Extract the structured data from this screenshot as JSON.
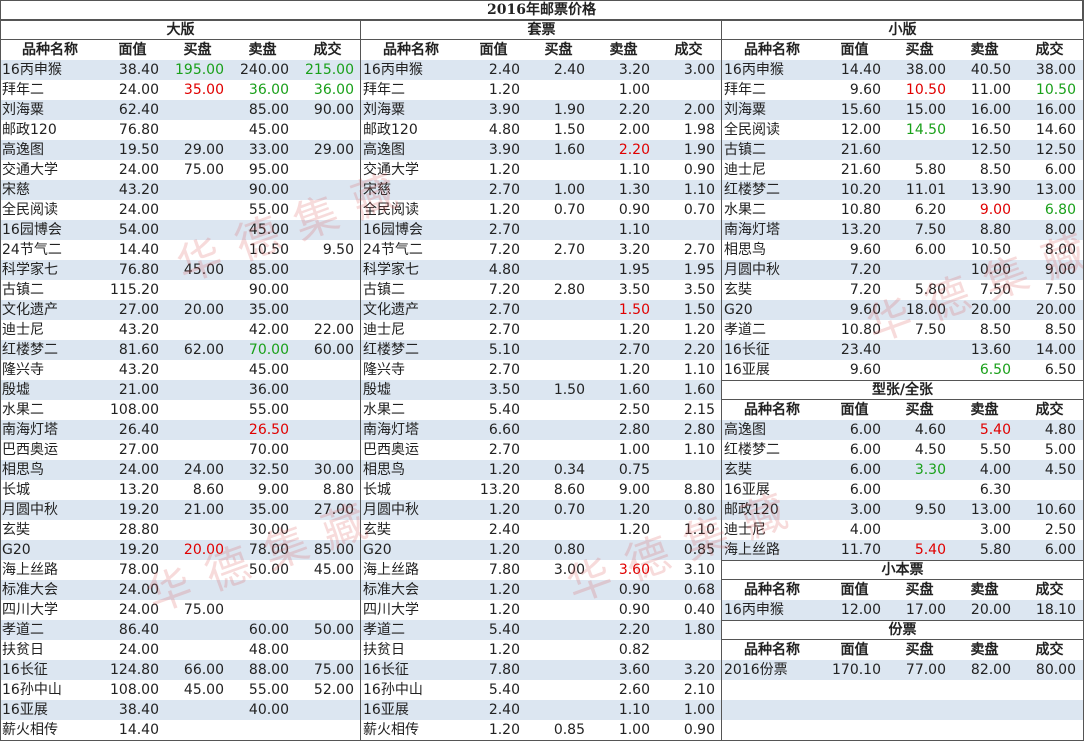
{
  "title": "2016年邮票价格",
  "headers": [
    "品种名称",
    "面值",
    "买盘",
    "卖盘",
    "成交"
  ],
  "watermark_text": "华德集藏",
  "colors": {
    "stripe": "#dce6f1",
    "red": "#e00000",
    "green": "#1aa01a"
  },
  "sections": {
    "daban": {
      "title": "大版",
      "rows": [
        [
          "16丙申猴",
          "38.40",
          "195.00",
          "240.00",
          "215.00"
        ],
        [
          "拜年二",
          "24.00",
          "35.00",
          "36.00",
          "36.00"
        ],
        [
          "刘海粟",
          "62.40",
          "",
          "85.00",
          "90.00"
        ],
        [
          "邮政120",
          "76.80",
          "",
          "45.00",
          ""
        ],
        [
          "高逸图",
          "19.50",
          "29.00",
          "33.00",
          "29.00"
        ],
        [
          "交通大学",
          "24.00",
          "75.00",
          "95.00",
          ""
        ],
        [
          "宋慈",
          "43.20",
          "",
          "90.00",
          ""
        ],
        [
          "全民阅读",
          "24.00",
          "",
          "55.00",
          ""
        ],
        [
          "16园博会",
          "54.00",
          "",
          "45.00",
          ""
        ],
        [
          "24节气二",
          "14.40",
          "",
          "10.50",
          "9.50"
        ],
        [
          "科学家七",
          "76.80",
          "45.00",
          "85.00",
          ""
        ],
        [
          "古镇二",
          "115.20",
          "",
          "90.00",
          ""
        ],
        [
          "文化遗产",
          "27.00",
          "20.00",
          "35.00",
          ""
        ],
        [
          "迪士尼",
          "43.20",
          "",
          "42.00",
          "22.00"
        ],
        [
          "红楼梦二",
          "81.60",
          "62.00",
          "70.00",
          "60.00"
        ],
        [
          "隆兴寺",
          "43.20",
          "",
          "45.00",
          ""
        ],
        [
          "殷墟",
          "21.00",
          "",
          "36.00",
          ""
        ],
        [
          "水果二",
          "108.00",
          "",
          "55.00",
          ""
        ],
        [
          "南海灯塔",
          "26.40",
          "",
          "26.50",
          ""
        ],
        [
          "巴西奥运",
          "27.00",
          "",
          "70.00",
          ""
        ],
        [
          "相思鸟",
          "24.00",
          "24.00",
          "32.50",
          "30.00"
        ],
        [
          "长城",
          "13.20",
          "8.60",
          "9.00",
          "8.80"
        ],
        [
          "月圆中秋",
          "19.20",
          "21.00",
          "35.00",
          "27.00"
        ],
        [
          "玄奘",
          "28.80",
          "",
          "30.00",
          ""
        ],
        [
          "G20",
          "19.20",
          "20.00",
          "78.00",
          "85.00"
        ],
        [
          "海上丝路",
          "78.00",
          "",
          "50.00",
          "45.00"
        ],
        [
          "标准大会",
          "24.00",
          "",
          "",
          ""
        ],
        [
          "四川大学",
          "24.00",
          "75.00",
          "",
          ""
        ],
        [
          "孝道二",
          "86.40",
          "",
          "60.00",
          "50.00"
        ],
        [
          "扶贫日",
          "24.00",
          "",
          "48.00",
          ""
        ],
        [
          "16长征",
          "124.80",
          "66.00",
          "88.00",
          "75.00"
        ],
        [
          "16孙中山",
          "108.00",
          "45.00",
          "55.00",
          "52.00"
        ],
        [
          "16亚展",
          "38.40",
          "",
          "40.00",
          ""
        ],
        [
          "薪火相传",
          "14.40",
          "",
          "",
          ""
        ]
      ],
      "colored": {
        "0": {
          "2": "green",
          "4": "green"
        },
        "1": {
          "2": "red",
          "3": "green",
          "4": "green"
        },
        "14": {
          "3": "green"
        },
        "18": {
          "3": "red"
        },
        "24": {
          "2": "red"
        }
      }
    },
    "taopiao": {
      "title": "套票",
      "rows": [
        [
          "16丙申猴",
          "2.40",
          "2.40",
          "3.20",
          "3.00"
        ],
        [
          "拜年二",
          "1.20",
          "",
          "1.00",
          ""
        ],
        [
          "刘海粟",
          "3.90",
          "1.90",
          "2.20",
          "2.00"
        ],
        [
          "邮政120",
          "4.80",
          "1.50",
          "2.00",
          "1.98"
        ],
        [
          "高逸图",
          "3.90",
          "1.60",
          "2.20",
          "1.90"
        ],
        [
          "交通大学",
          "1.20",
          "",
          "1.10",
          "0.90"
        ],
        [
          "宋慈",
          "2.70",
          "1.00",
          "1.30",
          "1.10"
        ],
        [
          "全民阅读",
          "1.20",
          "0.70",
          "0.90",
          "0.70"
        ],
        [
          "16园博会",
          "2.70",
          "",
          "1.10",
          ""
        ],
        [
          "24节气二",
          "7.20",
          "2.70",
          "3.20",
          "2.70"
        ],
        [
          "科学家七",
          "4.80",
          "",
          "1.95",
          "1.95"
        ],
        [
          "古镇二",
          "7.20",
          "2.80",
          "3.50",
          "3.50"
        ],
        [
          "文化遗产",
          "2.70",
          "",
          "1.50",
          "1.50"
        ],
        [
          "迪士尼",
          "2.70",
          "",
          "1.20",
          "1.20"
        ],
        [
          "红楼梦二",
          "5.10",
          "",
          "2.70",
          "2.20"
        ],
        [
          "隆兴寺",
          "2.70",
          "",
          "1.20",
          "1.10"
        ],
        [
          "殷墟",
          "3.50",
          "1.50",
          "1.60",
          "1.60"
        ],
        [
          "水果二",
          "5.40",
          "",
          "2.50",
          "2.15"
        ],
        [
          "南海灯塔",
          "6.60",
          "",
          "2.80",
          "2.80"
        ],
        [
          "巴西奥运",
          "2.70",
          "",
          "1.00",
          "1.10"
        ],
        [
          "相思鸟",
          "1.20",
          "0.34",
          "0.75",
          ""
        ],
        [
          "长城",
          "13.20",
          "8.60",
          "9.00",
          "8.80"
        ],
        [
          "月圆中秋",
          "1.20",
          "0.70",
          "1.20",
          "0.80"
        ],
        [
          "玄奘",
          "2.40",
          "",
          "1.20",
          "1.10"
        ],
        [
          "G20",
          "1.20",
          "0.80",
          "",
          "0.85"
        ],
        [
          "海上丝路",
          "7.80",
          "3.00",
          "3.60",
          "3.10"
        ],
        [
          "标准大会",
          "1.20",
          "",
          "0.90",
          "0.68"
        ],
        [
          "四川大学",
          "1.20",
          "",
          "0.90",
          "0.40"
        ],
        [
          "孝道二",
          "5.40",
          "",
          "2.20",
          "1.80"
        ],
        [
          "扶贫日",
          "1.20",
          "",
          "0.82",
          ""
        ],
        [
          "16长征",
          "7.80",
          "",
          "3.60",
          "3.20"
        ],
        [
          "16孙中山",
          "5.40",
          "",
          "2.60",
          "2.10"
        ],
        [
          "16亚展",
          "2.40",
          "",
          "1.10",
          "1.00"
        ],
        [
          "薪火相传",
          "1.20",
          "0.85",
          "1.00",
          "0.90"
        ]
      ],
      "colored": {
        "4": {
          "3": "red"
        },
        "12": {
          "3": "red"
        },
        "25": {
          "3": "red"
        }
      }
    },
    "xiaoban": {
      "title": "小版",
      "rows": [
        [
          "16丙申猴",
          "14.40",
          "38.00",
          "40.50",
          "38.00"
        ],
        [
          "拜年二",
          "9.60",
          "10.50",
          "11.00",
          "10.50"
        ],
        [
          "刘海粟",
          "15.60",
          "15.00",
          "16.00",
          "16.00"
        ],
        [
          "全民阅读",
          "12.00",
          "14.50",
          "16.50",
          "14.60"
        ],
        [
          "古镇二",
          "21.60",
          "",
          "12.50",
          "12.50"
        ],
        [
          "迪士尼",
          "21.60",
          "5.80",
          "8.50",
          "6.00"
        ],
        [
          "红楼梦二",
          "10.20",
          "11.01",
          "13.90",
          "13.00"
        ],
        [
          "水果二",
          "10.80",
          "6.20",
          "9.00",
          "6.80"
        ],
        [
          "南海灯塔",
          "13.20",
          "7.50",
          "8.80",
          "8.00"
        ],
        [
          "相思鸟",
          "9.60",
          "6.00",
          "10.50",
          "8.00"
        ],
        [
          "月圆中秋",
          "7.20",
          "",
          "10.00",
          "9.00"
        ],
        [
          "玄奘",
          "7.20",
          "5.80",
          "7.50",
          "7.50"
        ],
        [
          "G20",
          "9.60",
          "18.00",
          "20.00",
          "20.00"
        ],
        [
          "孝道二",
          "10.80",
          "7.50",
          "8.50",
          "8.50"
        ],
        [
          "16长征",
          "23.40",
          "",
          "13.60",
          "14.00"
        ],
        [
          "16亚展",
          "9.60",
          "",
          "6.50",
          "6.50"
        ]
      ],
      "colored": {
        "1": {
          "2": "red",
          "4": "green"
        },
        "3": {
          "2": "green"
        },
        "7": {
          "3": "red",
          "4": "green"
        },
        "15": {
          "3": "green"
        }
      }
    },
    "xingzhang": {
      "title": "型张/全张",
      "rows": [
        [
          "高逸图",
          "6.00",
          "4.60",
          "5.40",
          "4.80"
        ],
        [
          "红楼梦二",
          "6.00",
          "4.50",
          "5.50",
          "5.00"
        ],
        [
          "玄奘",
          "6.00",
          "3.30",
          "4.00",
          "4.50"
        ],
        [
          "16亚展",
          "6.00",
          "",
          "6.30",
          ""
        ],
        [
          "邮政120",
          "3.00",
          "9.50",
          "13.00",
          "10.60"
        ],
        [
          "迪士尼",
          "4.00",
          "",
          "3.00",
          "2.50"
        ],
        [
          "海上丝路",
          "11.70",
          "5.40",
          "5.80",
          "6.00"
        ]
      ],
      "colored": {
        "0": {
          "3": "red"
        },
        "2": {
          "2": "green"
        },
        "6": {
          "2": "red"
        }
      }
    },
    "xiaoben": {
      "title": "小本票",
      "rows": [
        [
          "16丙申猴",
          "12.00",
          "17.00",
          "20.00",
          "18.10"
        ]
      ],
      "colored": {}
    },
    "fenpiao": {
      "title": "份票",
      "rows": [
        [
          "2016份票",
          "170.10",
          "77.00",
          "82.00",
          "80.00"
        ]
      ],
      "colored": {}
    }
  }
}
